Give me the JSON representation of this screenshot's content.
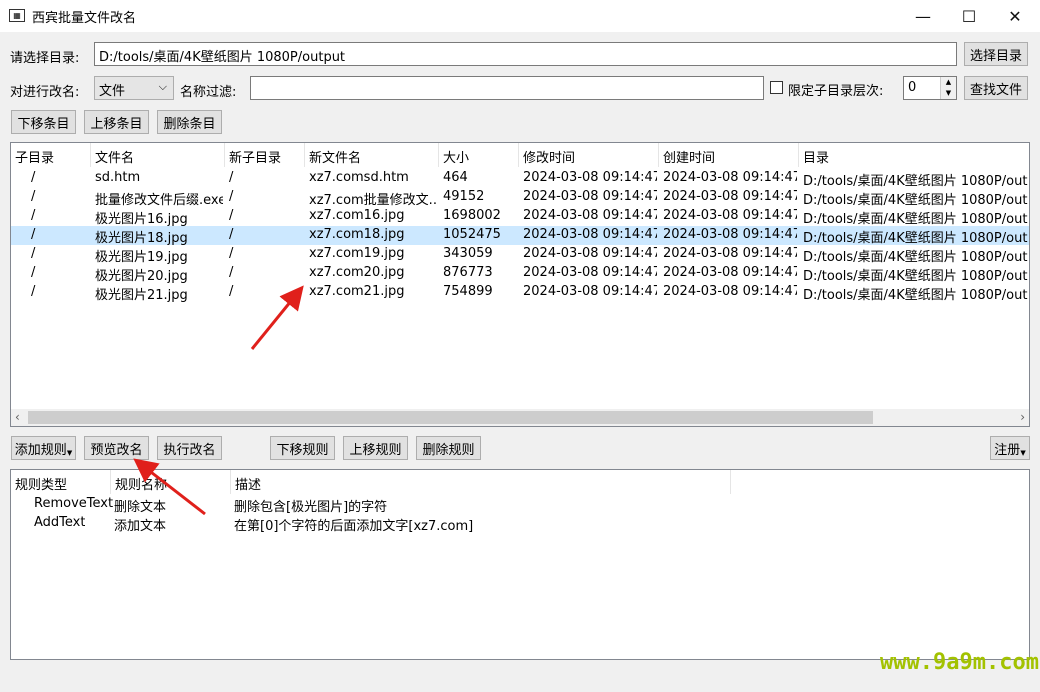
{
  "window": {
    "title": "西宾批量文件改名",
    "minimize": "—",
    "maximize": "☐",
    "close": "✕"
  },
  "dir": {
    "label": "请选择目录:",
    "value": "D:/tools/桌面/4K壁纸图片 1080P/output",
    "choose_btn": "选择目录"
  },
  "filter": {
    "target_label": "对进行改名:",
    "target_value": "文件",
    "name_filter_label": "名称过滤:",
    "name_filter_value": "",
    "limit_label": "限定子目录层次:",
    "depth": "0",
    "find_btn": "查找文件"
  },
  "item_toolbar": {
    "down": "下移条目",
    "up": "上移条目",
    "delete": "删除条目"
  },
  "file_table": {
    "columns": [
      "子目录",
      "文件名",
      "新子目录",
      "新文件名",
      "大小",
      "修改时间",
      "创建时间",
      "目录"
    ],
    "rows": [
      [
        "/",
        "sd.htm",
        "/",
        "xz7.comsd.htm",
        "464",
        "2024-03-08 09:14:47",
        "2024-03-08 09:14:47",
        "D:/tools/桌面/4K壁纸图片 1080P/out"
      ],
      [
        "/",
        "批量修改文件后缀.exe",
        "/",
        "xz7.com批量修改文...",
        "49152",
        "2024-03-08 09:14:47",
        "2024-03-08 09:14:47",
        "D:/tools/桌面/4K壁纸图片 1080P/out"
      ],
      [
        "/",
        "极光图片16.jpg",
        "/",
        "xz7.com16.jpg",
        "1698002",
        "2024-03-08 09:14:47",
        "2024-03-08 09:14:47",
        "D:/tools/桌面/4K壁纸图片 1080P/out"
      ],
      [
        "/",
        "极光图片18.jpg",
        "/",
        "xz7.com18.jpg",
        "1052475",
        "2024-03-08 09:14:47",
        "2024-03-08 09:14:47",
        "D:/tools/桌面/4K壁纸图片 1080P/out"
      ],
      [
        "/",
        "极光图片19.jpg",
        "/",
        "xz7.com19.jpg",
        "343059",
        "2024-03-08 09:14:47",
        "2024-03-08 09:14:47",
        "D:/tools/桌面/4K壁纸图片 1080P/out"
      ],
      [
        "/",
        "极光图片20.jpg",
        "/",
        "xz7.com20.jpg",
        "876773",
        "2024-03-08 09:14:47",
        "2024-03-08 09:14:47",
        "D:/tools/桌面/4K壁纸图片 1080P/out"
      ],
      [
        "/",
        "极光图片21.jpg",
        "/",
        "xz7.com21.jpg",
        "754899",
        "2024-03-08 09:14:47",
        "2024-03-08 09:14:47",
        "D:/tools/桌面/4K壁纸图片 1080P/out"
      ]
    ],
    "selected_row": 3
  },
  "rule_toolbar": {
    "add": "添加规则",
    "preview": "预览改名",
    "execute": "执行改名",
    "down": "下移规则",
    "up": "上移规则",
    "delete": "删除规则",
    "register": "注册"
  },
  "rule_table": {
    "columns": [
      "规则类型",
      "规则名称",
      "描述"
    ],
    "rows": [
      [
        "RemoveText",
        "删除文本",
        "删除包含[极光图片]的字符"
      ],
      [
        "AddText",
        "添加文本",
        "在第[0]个字符的后面添加文字[xz7.com]"
      ]
    ]
  },
  "watermark": "www.9a9m.com",
  "colors": {
    "selection": "#cce8ff",
    "arrow": "#e0201b",
    "watermark": "#a3c200"
  }
}
